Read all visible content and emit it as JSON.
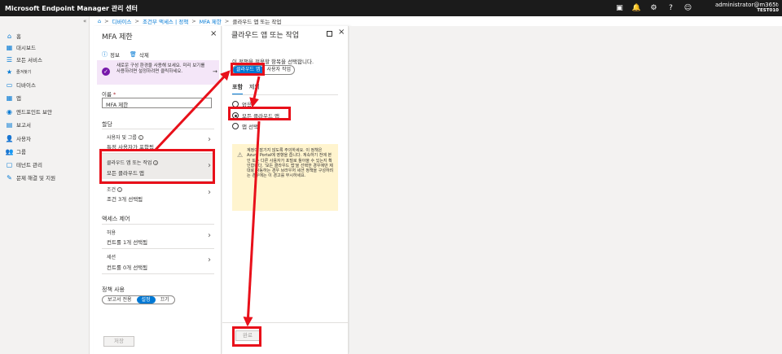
{
  "topbar": {
    "title": "Microsoft Endpoint Manager 관리 센터",
    "icons": [
      {
        "name": "feedback-icon",
        "glyph": "▣"
      },
      {
        "name": "bell-icon",
        "glyph": "🔔"
      },
      {
        "name": "gear-icon",
        "glyph": "⚙"
      },
      {
        "name": "help-icon",
        "glyph": "?"
      },
      {
        "name": "smiley-icon",
        "glyph": "☺"
      }
    ],
    "user_name": "administrator@m365tes...",
    "tenant": "TEST010"
  },
  "leftnav": {
    "collapse": "«",
    "items": [
      {
        "name": "home",
        "glyph": "⌂",
        "label": "홈"
      },
      {
        "name": "dashboard",
        "glyph": "▦",
        "label": "대시보드"
      },
      {
        "name": "all-services",
        "glyph": "☰",
        "label": "모든 서비스"
      },
      {
        "name": "favorites",
        "glyph": "★",
        "label": "즐겨찾기"
      },
      {
        "name": "devices",
        "glyph": "▭",
        "label": "디바이스"
      },
      {
        "name": "apps",
        "glyph": "▦",
        "label": "앱"
      },
      {
        "name": "endpoint-security",
        "glyph": "◉",
        "label": "엔드포인트 보안"
      },
      {
        "name": "reports",
        "glyph": "▤",
        "label": "보고서"
      },
      {
        "name": "users",
        "glyph": "👤",
        "label": "사용자"
      },
      {
        "name": "groups",
        "glyph": "👥",
        "label": "그룹"
      },
      {
        "name": "tenant-admin",
        "glyph": "▢",
        "label": "테넌트 관리"
      },
      {
        "name": "troubleshooting",
        "glyph": "✎",
        "label": "문제 해결 및 지원"
      }
    ]
  },
  "breadcrumb": {
    "home_glyph": "⌂",
    "items": [
      "디바이스",
      "조건부 액세스 | 정책",
      "MFA 제한"
    ],
    "current": "클라우드 앱 또는 작업"
  },
  "blade1": {
    "title": "MFA 제한",
    "close": "×",
    "toolbar": {
      "info": "정보",
      "delete": "삭제"
    },
    "banner": {
      "text": "새로운 구성 환경을 사용해 보세요. 미리 보기를 사용하려면 설정하려면 클릭하세요.",
      "arrow": "→"
    },
    "name_label": "이름",
    "name_required": "*",
    "name_value": "MFA 제한",
    "assignments_label": "할당",
    "users_title": "사용자 및 그룹",
    "users_value": "특정 사용자가 포함됨",
    "apps_title": "클라우드 앱 또는 작업",
    "apps_value": "모든 클라우드 앱",
    "conditions_title": "조건",
    "conditions_value": "조건 3개 선택됨",
    "access_label": "액세스 제어",
    "grant_title": "허용",
    "grant_value": "컨트롤 1개 선택됨",
    "session_title": "세션",
    "session_value": "컨트롤 0개 선택됨",
    "enable_label": "정책 사용",
    "toggle": [
      "보고서 전용",
      "설정",
      "끄기"
    ],
    "save": "저장"
  },
  "blade2": {
    "title": "클라우드 앱 또는 작업",
    "desc": "이 정책을 적용할 항목을 선택합니다.",
    "pills": [
      "클라우드 앱",
      "사용자 작업"
    ],
    "tabs": [
      "포함",
      "제외"
    ],
    "radios": [
      "없음",
      "모든 클라우드 앱",
      "앱 선택"
    ],
    "warning": "계정이 잠기지 않도록 주의하세요. 이 정책은 Azure Portal에 영향을 줍니다. 계속하기 전에 본인 또는 다른 사용자가 포털로 돌아올 수 있는지 확인합니다. '모든 클라우드 앱'을 선택한 경우에만 제대로 작동하는 경우 브라우저 세션 정책을 구성하려는 경우에는 이 경고를 무시하세요.",
    "done": "완료"
  },
  "colors": {
    "accent": "#0078d4",
    "annotation": "#e8101a",
    "topbar": "#1b1b1b"
  }
}
